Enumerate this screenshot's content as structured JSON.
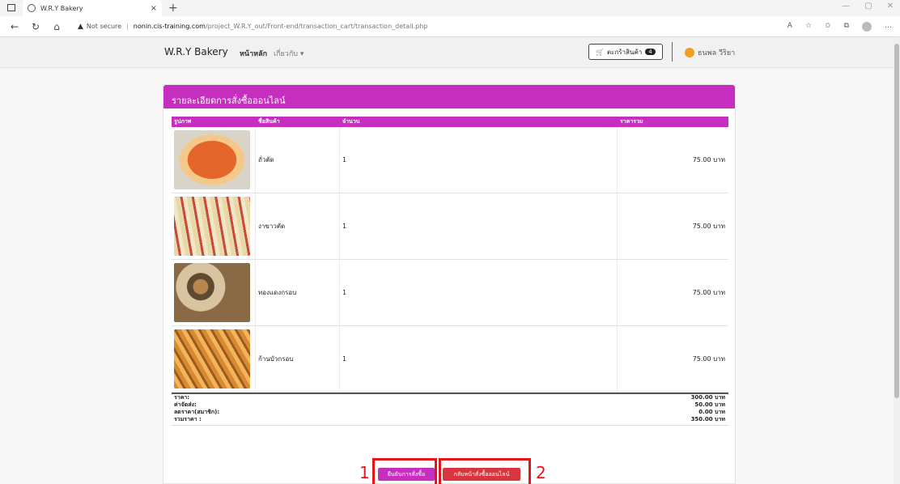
{
  "browser": {
    "tab_title": "W.R.Y Bakery",
    "url_warning": "Not secure",
    "url_host": "nonin.cis-training.com",
    "url_path": "/project_W.R.Y_out/Front-end/transaction_cart/transaction_detail.php"
  },
  "site": {
    "brand": "W.R.Y Bakery",
    "nav_home": "หน้าหลัก",
    "nav_about": "เกี่ยวกับ ▾",
    "cart_label": "ตะกร้าสินค้า",
    "cart_count": "4",
    "user_name": "ธนพล วีริยา"
  },
  "card": {
    "title": "รายละเอียดการสั่งซื้อออนไลน์",
    "columns": [
      "รูปภาพ",
      "ชื่อสินค้า",
      "จำนวน",
      "ราคารวม"
    ],
    "rows": [
      {
        "name": "ถั่วตัด",
        "qty": "1",
        "total": "75.00 บาท"
      },
      {
        "name": "งาขาวตัด",
        "qty": "1",
        "total": "75.00 บาท"
      },
      {
        "name": "ทองแดงกรอบ",
        "qty": "1",
        "total": "75.00 บาท"
      },
      {
        "name": "ก้านบัวกรอบ",
        "qty": "1",
        "total": "75.00 บาท"
      }
    ],
    "summary": [
      {
        "label": "ราคา:",
        "value": "300.00 บาท"
      },
      {
        "label": "ค่าจัดส่ง:",
        "value": "50.00 บาท"
      },
      {
        "label": "ลดราคา(สมาชิก):",
        "value": "0.00 บาท"
      },
      {
        "label": "รวมราคา :",
        "value": "350.00 บาท"
      }
    ]
  },
  "actions": {
    "confirm": "ยืนยันการสั่งซื้อ",
    "back": "กลับหน้าสั่งซื้อออนไลน์",
    "mark1": "1",
    "mark2": "2"
  },
  "colors": {
    "accent": "#c62ec0",
    "danger": "#d9353e",
    "annotation": "#e8141c"
  }
}
